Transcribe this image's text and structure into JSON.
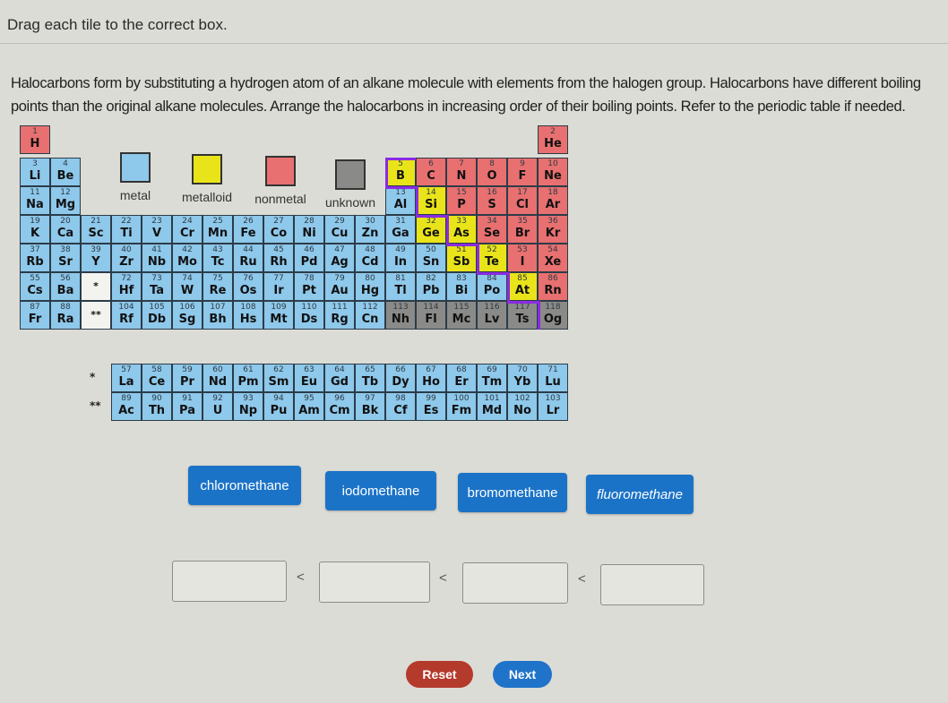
{
  "instruction": "Drag each tile to the correct box.",
  "prompt": "Halocarbons form by substituting a hydrogen atom of an alkane molecule with elements from the halogen group. Halocarbons have different boiling points than the original alkane molecules. Arrange the halocarbons in increasing order of their boiling points. Refer to the periodic table if needed.",
  "legend": [
    {
      "label": "metal",
      "type": "metal"
    },
    {
      "label": "metalloid",
      "type": "metalloid"
    },
    {
      "label": "nonmetal",
      "type": "nonmetal"
    },
    {
      "label": "unknown",
      "type": "unknown"
    }
  ],
  "colors": {
    "metal": "#8ec8ea",
    "metalloid": "#e9e41a",
    "nonmetal": "#e87070",
    "unknown": "#8a8a88",
    "tile": "#1b73c7",
    "reset": "#b43a2c",
    "next": "#1f74c9",
    "metalloid_border": "#8a2be2"
  },
  "elements": [
    {
      "n": "1",
      "s": "H",
      "r": 1,
      "c": 1,
      "t": "nonmetal"
    },
    {
      "n": "2",
      "s": "He",
      "r": 1,
      "c": 18,
      "t": "nonmetal"
    },
    {
      "n": "3",
      "s": "Li",
      "r": 2,
      "c": 1,
      "t": "metal"
    },
    {
      "n": "4",
      "s": "Be",
      "r": 2,
      "c": 2,
      "t": "metal"
    },
    {
      "n": "5",
      "s": "B",
      "r": 2,
      "c": 13,
      "t": "metalloid"
    },
    {
      "n": "6",
      "s": "C",
      "r": 2,
      "c": 14,
      "t": "nonmetal"
    },
    {
      "n": "7",
      "s": "N",
      "r": 2,
      "c": 15,
      "t": "nonmetal"
    },
    {
      "n": "8",
      "s": "O",
      "r": 2,
      "c": 16,
      "t": "nonmetal"
    },
    {
      "n": "9",
      "s": "F",
      "r": 2,
      "c": 17,
      "t": "nonmetal"
    },
    {
      "n": "10",
      "s": "Ne",
      "r": 2,
      "c": 18,
      "t": "nonmetal"
    },
    {
      "n": "11",
      "s": "Na",
      "r": 3,
      "c": 1,
      "t": "metal"
    },
    {
      "n": "12",
      "s": "Mg",
      "r": 3,
      "c": 2,
      "t": "metal"
    },
    {
      "n": "13",
      "s": "Al",
      "r": 3,
      "c": 13,
      "t": "metal"
    },
    {
      "n": "14",
      "s": "Si",
      "r": 3,
      "c": 14,
      "t": "metalloid"
    },
    {
      "n": "15",
      "s": "P",
      "r": 3,
      "c": 15,
      "t": "nonmetal"
    },
    {
      "n": "16",
      "s": "S",
      "r": 3,
      "c": 16,
      "t": "nonmetal"
    },
    {
      "n": "17",
      "s": "Cl",
      "r": 3,
      "c": 17,
      "t": "nonmetal"
    },
    {
      "n": "18",
      "s": "Ar",
      "r": 3,
      "c": 18,
      "t": "nonmetal"
    },
    {
      "n": "19",
      "s": "K",
      "r": 4,
      "c": 1,
      "t": "metal"
    },
    {
      "n": "20",
      "s": "Ca",
      "r": 4,
      "c": 2,
      "t": "metal"
    },
    {
      "n": "21",
      "s": "Sc",
      "r": 4,
      "c": 3,
      "t": "metal"
    },
    {
      "n": "22",
      "s": "Ti",
      "r": 4,
      "c": 4,
      "t": "metal"
    },
    {
      "n": "23",
      "s": "V",
      "r": 4,
      "c": 5,
      "t": "metal"
    },
    {
      "n": "24",
      "s": "Cr",
      "r": 4,
      "c": 6,
      "t": "metal"
    },
    {
      "n": "25",
      "s": "Mn",
      "r": 4,
      "c": 7,
      "t": "metal"
    },
    {
      "n": "26",
      "s": "Fe",
      "r": 4,
      "c": 8,
      "t": "metal"
    },
    {
      "n": "27",
      "s": "Co",
      "r": 4,
      "c": 9,
      "t": "metal"
    },
    {
      "n": "28",
      "s": "Ni",
      "r": 4,
      "c": 10,
      "t": "metal"
    },
    {
      "n": "29",
      "s": "Cu",
      "r": 4,
      "c": 11,
      "t": "metal"
    },
    {
      "n": "30",
      "s": "Zn",
      "r": 4,
      "c": 12,
      "t": "metal"
    },
    {
      "n": "31",
      "s": "Ga",
      "r": 4,
      "c": 13,
      "t": "metal"
    },
    {
      "n": "32",
      "s": "Ge",
      "r": 4,
      "c": 14,
      "t": "metalloid"
    },
    {
      "n": "33",
      "s": "As",
      "r": 4,
      "c": 15,
      "t": "metalloid"
    },
    {
      "n": "34",
      "s": "Se",
      "r": 4,
      "c": 16,
      "t": "nonmetal"
    },
    {
      "n": "35",
      "s": "Br",
      "r": 4,
      "c": 17,
      "t": "nonmetal"
    },
    {
      "n": "36",
      "s": "Kr",
      "r": 4,
      "c": 18,
      "t": "nonmetal"
    },
    {
      "n": "37",
      "s": "Rb",
      "r": 5,
      "c": 1,
      "t": "metal"
    },
    {
      "n": "38",
      "s": "Sr",
      "r": 5,
      "c": 2,
      "t": "metal"
    },
    {
      "n": "39",
      "s": "Y",
      "r": 5,
      "c": 3,
      "t": "metal"
    },
    {
      "n": "40",
      "s": "Zr",
      "r": 5,
      "c": 4,
      "t": "metal"
    },
    {
      "n": "41",
      "s": "Nb",
      "r": 5,
      "c": 5,
      "t": "metal"
    },
    {
      "n": "42",
      "s": "Mo",
      "r": 5,
      "c": 6,
      "t": "metal"
    },
    {
      "n": "43",
      "s": "Tc",
      "r": 5,
      "c": 7,
      "t": "metal"
    },
    {
      "n": "44",
      "s": "Ru",
      "r": 5,
      "c": 8,
      "t": "metal"
    },
    {
      "n": "45",
      "s": "Rh",
      "r": 5,
      "c": 9,
      "t": "metal"
    },
    {
      "n": "46",
      "s": "Pd",
      "r": 5,
      "c": 10,
      "t": "metal"
    },
    {
      "n": "47",
      "s": "Ag",
      "r": 5,
      "c": 11,
      "t": "metal"
    },
    {
      "n": "48",
      "s": "Cd",
      "r": 5,
      "c": 12,
      "t": "metal"
    },
    {
      "n": "49",
      "s": "In",
      "r": 5,
      "c": 13,
      "t": "metal"
    },
    {
      "n": "50",
      "s": "Sn",
      "r": 5,
      "c": 14,
      "t": "metal"
    },
    {
      "n": "51",
      "s": "Sb",
      "r": 5,
      "c": 15,
      "t": "metalloid"
    },
    {
      "n": "52",
      "s": "Te",
      "r": 5,
      "c": 16,
      "t": "metalloid"
    },
    {
      "n": "53",
      "s": "I",
      "r": 5,
      "c": 17,
      "t": "nonmetal"
    },
    {
      "n": "54",
      "s": "Xe",
      "r": 5,
      "c": 18,
      "t": "nonmetal"
    },
    {
      "n": "55",
      "s": "Cs",
      "r": 6,
      "c": 1,
      "t": "metal"
    },
    {
      "n": "56",
      "s": "Ba",
      "r": 6,
      "c": 2,
      "t": "metal"
    },
    {
      "n": "",
      "s": "*",
      "r": 6,
      "c": 3,
      "t": "placeholder"
    },
    {
      "n": "72",
      "s": "Hf",
      "r": 6,
      "c": 4,
      "t": "metal"
    },
    {
      "n": "73",
      "s": "Ta",
      "r": 6,
      "c": 5,
      "t": "metal"
    },
    {
      "n": "74",
      "s": "W",
      "r": 6,
      "c": 6,
      "t": "metal"
    },
    {
      "n": "75",
      "s": "Re",
      "r": 6,
      "c": 7,
      "t": "metal"
    },
    {
      "n": "76",
      "s": "Os",
      "r": 6,
      "c": 8,
      "t": "metal"
    },
    {
      "n": "77",
      "s": "Ir",
      "r": 6,
      "c": 9,
      "t": "metal"
    },
    {
      "n": "78",
      "s": "Pt",
      "r": 6,
      "c": 10,
      "t": "metal"
    },
    {
      "n": "79",
      "s": "Au",
      "r": 6,
      "c": 11,
      "t": "metal"
    },
    {
      "n": "80",
      "s": "Hg",
      "r": 6,
      "c": 12,
      "t": "metal"
    },
    {
      "n": "81",
      "s": "Tl",
      "r": 6,
      "c": 13,
      "t": "metal"
    },
    {
      "n": "82",
      "s": "Pb",
      "r": 6,
      "c": 14,
      "t": "metal"
    },
    {
      "n": "83",
      "s": "Bi",
      "r": 6,
      "c": 15,
      "t": "metal"
    },
    {
      "n": "84",
      "s": "Po",
      "r": 6,
      "c": 16,
      "t": "metal"
    },
    {
      "n": "85",
      "s": "At",
      "r": 6,
      "c": 17,
      "t": "metalloid"
    },
    {
      "n": "86",
      "s": "Rn",
      "r": 6,
      "c": 18,
      "t": "nonmetal"
    },
    {
      "n": "87",
      "s": "Fr",
      "r": 7,
      "c": 1,
      "t": "metal"
    },
    {
      "n": "88",
      "s": "Ra",
      "r": 7,
      "c": 2,
      "t": "metal"
    },
    {
      "n": "",
      "s": "**",
      "r": 7,
      "c": 3,
      "t": "placeholder"
    },
    {
      "n": "104",
      "s": "Rf",
      "r": 7,
      "c": 4,
      "t": "metal"
    },
    {
      "n": "105",
      "s": "Db",
      "r": 7,
      "c": 5,
      "t": "metal"
    },
    {
      "n": "106",
      "s": "Sg",
      "r": 7,
      "c": 6,
      "t": "metal"
    },
    {
      "n": "107",
      "s": "Bh",
      "r": 7,
      "c": 7,
      "t": "metal"
    },
    {
      "n": "108",
      "s": "Hs",
      "r": 7,
      "c": 8,
      "t": "metal"
    },
    {
      "n": "109",
      "s": "Mt",
      "r": 7,
      "c": 9,
      "t": "metal"
    },
    {
      "n": "110",
      "s": "Ds",
      "r": 7,
      "c": 10,
      "t": "metal"
    },
    {
      "n": "111",
      "s": "Rg",
      "r": 7,
      "c": 11,
      "t": "metal"
    },
    {
      "n": "112",
      "s": "Cn",
      "r": 7,
      "c": 12,
      "t": "metal"
    },
    {
      "n": "113",
      "s": "Nh",
      "r": 7,
      "c": 13,
      "t": "unknown"
    },
    {
      "n": "114",
      "s": "Fl",
      "r": 7,
      "c": 14,
      "t": "unknown"
    },
    {
      "n": "115",
      "s": "Mc",
      "r": 7,
      "c": 15,
      "t": "unknown"
    },
    {
      "n": "116",
      "s": "Lv",
      "r": 7,
      "c": 16,
      "t": "unknown"
    },
    {
      "n": "117",
      "s": "Ts",
      "r": 7,
      "c": 17,
      "t": "unknown"
    },
    {
      "n": "118",
      "s": "Og",
      "r": 7,
      "c": 18,
      "t": "unknown"
    },
    {
      "n": "57",
      "s": "La",
      "r": 9,
      "c": 4,
      "t": "metal"
    },
    {
      "n": "58",
      "s": "Ce",
      "r": 9,
      "c": 5,
      "t": "metal"
    },
    {
      "n": "59",
      "s": "Pr",
      "r": 9,
      "c": 6,
      "t": "metal"
    },
    {
      "n": "60",
      "s": "Nd",
      "r": 9,
      "c": 7,
      "t": "metal"
    },
    {
      "n": "61",
      "s": "Pm",
      "r": 9,
      "c": 8,
      "t": "metal"
    },
    {
      "n": "62",
      "s": "Sm",
      "r": 9,
      "c": 9,
      "t": "metal"
    },
    {
      "n": "63",
      "s": "Eu",
      "r": 9,
      "c": 10,
      "t": "metal"
    },
    {
      "n": "64",
      "s": "Gd",
      "r": 9,
      "c": 11,
      "t": "metal"
    },
    {
      "n": "65",
      "s": "Tb",
      "r": 9,
      "c": 12,
      "t": "metal"
    },
    {
      "n": "66",
      "s": "Dy",
      "r": 9,
      "c": 13,
      "t": "metal"
    },
    {
      "n": "67",
      "s": "Ho",
      "r": 9,
      "c": 14,
      "t": "metal"
    },
    {
      "n": "68",
      "s": "Er",
      "r": 9,
      "c": 15,
      "t": "metal"
    },
    {
      "n": "69",
      "s": "Tm",
      "r": 9,
      "c": 16,
      "t": "metal"
    },
    {
      "n": "70",
      "s": "Yb",
      "r": 9,
      "c": 17,
      "t": "metal"
    },
    {
      "n": "71",
      "s": "Lu",
      "r": 9,
      "c": 18,
      "t": "metal"
    },
    {
      "n": "89",
      "s": "Ac",
      "r": 10,
      "c": 4,
      "t": "metal"
    },
    {
      "n": "90",
      "s": "Th",
      "r": 10,
      "c": 5,
      "t": "metal"
    },
    {
      "n": "91",
      "s": "Pa",
      "r": 10,
      "c": 6,
      "t": "metal"
    },
    {
      "n": "92",
      "s": "U",
      "r": 10,
      "c": 7,
      "t": "metal"
    },
    {
      "n": "93",
      "s": "Np",
      "r": 10,
      "c": 8,
      "t": "metal"
    },
    {
      "n": "94",
      "s": "Pu",
      "r": 10,
      "c": 9,
      "t": "metal"
    },
    {
      "n": "95",
      "s": "Am",
      "r": 10,
      "c": 10,
      "t": "metal"
    },
    {
      "n": "96",
      "s": "Cm",
      "r": 10,
      "c": 11,
      "t": "metal"
    },
    {
      "n": "97",
      "s": "Bk",
      "r": 10,
      "c": 12,
      "t": "metal"
    },
    {
      "n": "98",
      "s": "Cf",
      "r": 10,
      "c": 13,
      "t": "metal"
    },
    {
      "n": "99",
      "s": "Es",
      "r": 10,
      "c": 14,
      "t": "metal"
    },
    {
      "n": "100",
      "s": "Fm",
      "r": 10,
      "c": 15,
      "t": "metal"
    },
    {
      "n": "101",
      "s": "Md",
      "r": 10,
      "c": 16,
      "t": "metal"
    },
    {
      "n": "102",
      "s": "No",
      "r": 10,
      "c": 17,
      "t": "metal"
    },
    {
      "n": "103",
      "s": "Lr",
      "r": 10,
      "c": 18,
      "t": "metal"
    }
  ],
  "series_markers": {
    "lanthanide": "*",
    "actinide": "**"
  },
  "tiles": [
    {
      "label": "chloromethane",
      "italic": false
    },
    {
      "label": "iodomethane",
      "italic": false
    },
    {
      "label": "bromomethane",
      "italic": false
    },
    {
      "label": "fluoromethane",
      "italic": true
    }
  ],
  "answer_slots": [
    "",
    "",
    "",
    ""
  ],
  "comparator": "<",
  "buttons": {
    "reset": "Reset",
    "next": "Next"
  }
}
